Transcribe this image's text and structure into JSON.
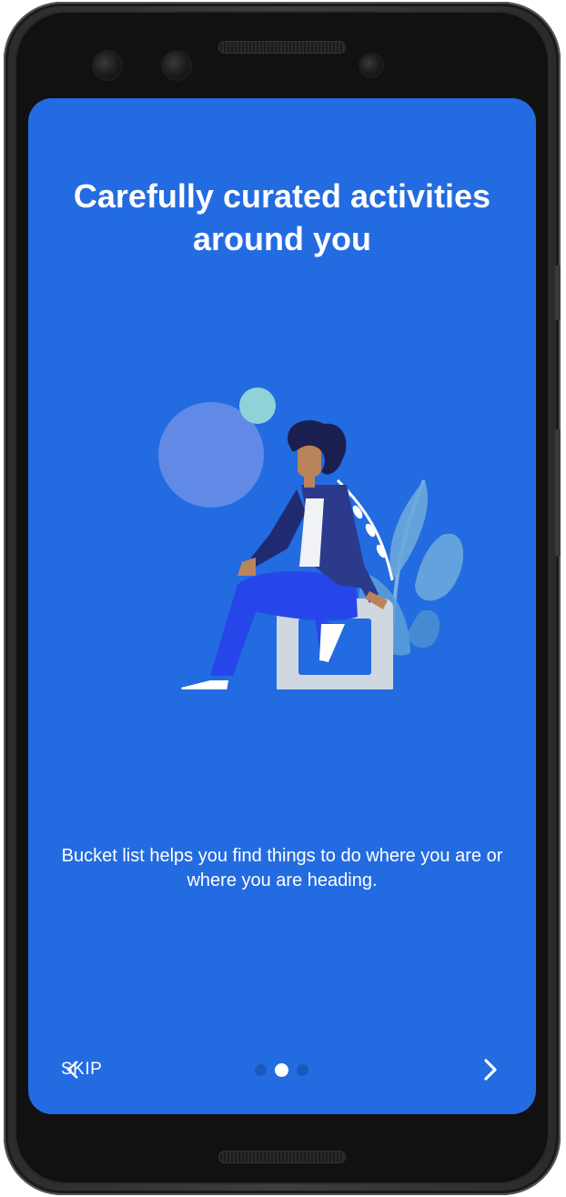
{
  "onboarding": {
    "title": "Carefully curated activities around you",
    "description": "Bucket list helps you find things to do where you are or where you are heading.",
    "skip_label": "SKIP",
    "page_indicator": {
      "current": 2,
      "total": 3
    },
    "next_icon": "chevron-right-icon"
  },
  "colors": {
    "background": "#236be0",
    "text": "#ffffff",
    "dot_inactive": "#1c58bb",
    "dot_active": "#ffffff"
  }
}
